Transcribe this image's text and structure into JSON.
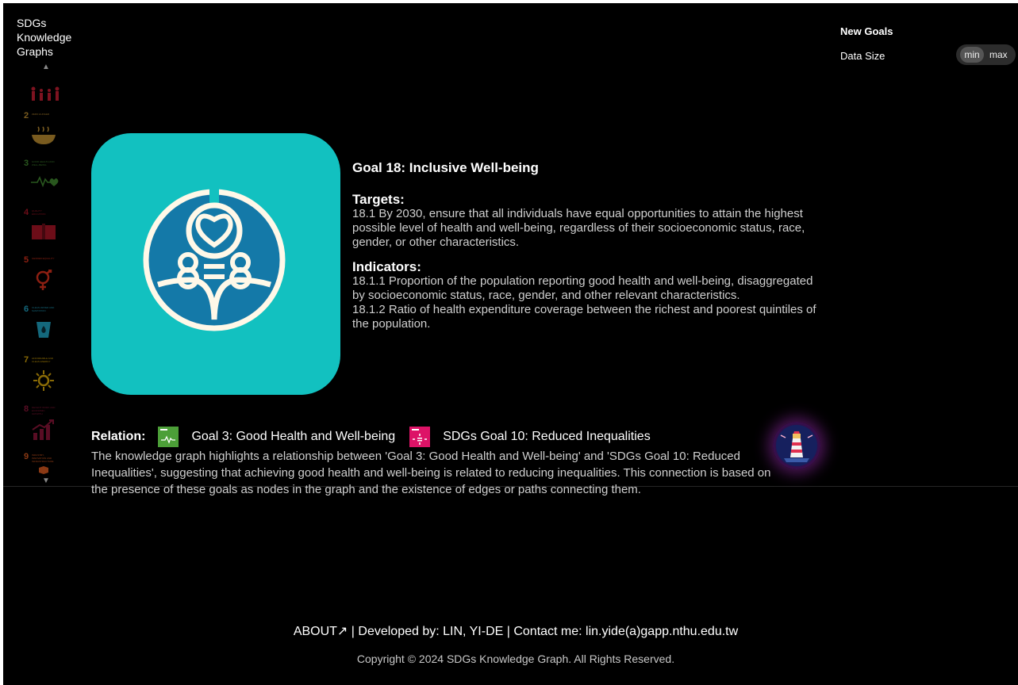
{
  "brand": {
    "title": "SDGs Knowledge Graphs"
  },
  "sidebar": {
    "up_arrow": "▲",
    "down_arrow": "▼",
    "items": [
      {
        "number": "",
        "label": "NO POVERTY",
        "color": "#e5243b",
        "icon": "family-icon"
      },
      {
        "number": "2",
        "label": "ZERO HUNGER",
        "color": "#dda63a",
        "icon": "bowl-icon"
      },
      {
        "number": "3",
        "label": "GOOD HEALTH AND WELL-BEING",
        "color": "#4c9f38",
        "icon": "heartbeat-icon"
      },
      {
        "number": "4",
        "label": "QUALITY EDUCATION",
        "color": "#c5192d",
        "icon": "book-icon"
      },
      {
        "number": "5",
        "label": "GENDER EQUALITY",
        "color": "#ff3a21",
        "icon": "gender-icon"
      },
      {
        "number": "6",
        "label": "CLEAN WATER AND SANITATION",
        "color": "#26bde2",
        "icon": "water-icon"
      },
      {
        "number": "7",
        "label": "AFFORDABLE AND CLEAN ENERGY",
        "color": "#fcc30b",
        "icon": "sun-icon"
      },
      {
        "number": "8",
        "label": "DECENT WORK AND ECONOMIC GROWTH",
        "color": "#a21942",
        "icon": "growth-icon"
      },
      {
        "number": "9",
        "label": "INDUSTRY, INNOVATION AND INFRASTRUCTURE",
        "color": "#fd6925",
        "icon": "cubes-icon"
      }
    ]
  },
  "controls": {
    "new_goals_label": "New Goals",
    "data_size_label": "Data Size",
    "min_label": "min",
    "max_label": "max"
  },
  "goal": {
    "title": "Goal 18: Inclusive Well-being",
    "card_color": "#12c1c0",
    "targets_heading": "Targets:",
    "targets_text": "18.1 By 2030, ensure that all individuals have equal opportunities to attain the highest possible level of health and well-being, regardless of their socioeconomic status, race, gender, or other characteristics.",
    "indicators_heading": "Indicators:",
    "indicator_1": "18.1.1 Proportion of the population reporting good health and well-being, disaggregated by socioeconomic status, race, gender, and other relevant characteristics.",
    "indicator_2": "18.1.2 Ratio of health expenditure coverage between the richest and poorest quintiles of the population."
  },
  "relation": {
    "label": "Relation:",
    "goal_a": {
      "text": "Goal 3: Good Health and Well-being",
      "color": "#4c9f38"
    },
    "goal_b": {
      "text": "SDGs Goal 10: Reduced Inequalities",
      "color": "#dd1367"
    },
    "description": "The knowledge graph highlights a relationship between 'Goal 3: Good Health and Well-being' and 'SDGs Goal 10: Reduced Inequalities', suggesting that achieving good health and well-being is related to reducing inequalities. This connection is based on the presence of these goals as nodes in the graph and the existence of edges or paths connecting them."
  },
  "footer": {
    "links": "ABOUT↗ | Developed by: LIN, YI-DE | Contact me: lin.yide(a)gapp.nthu.edu.tw",
    "copyright": "Copyright © 2024 SDGs Knowledge Graph. All Rights Reserved."
  }
}
